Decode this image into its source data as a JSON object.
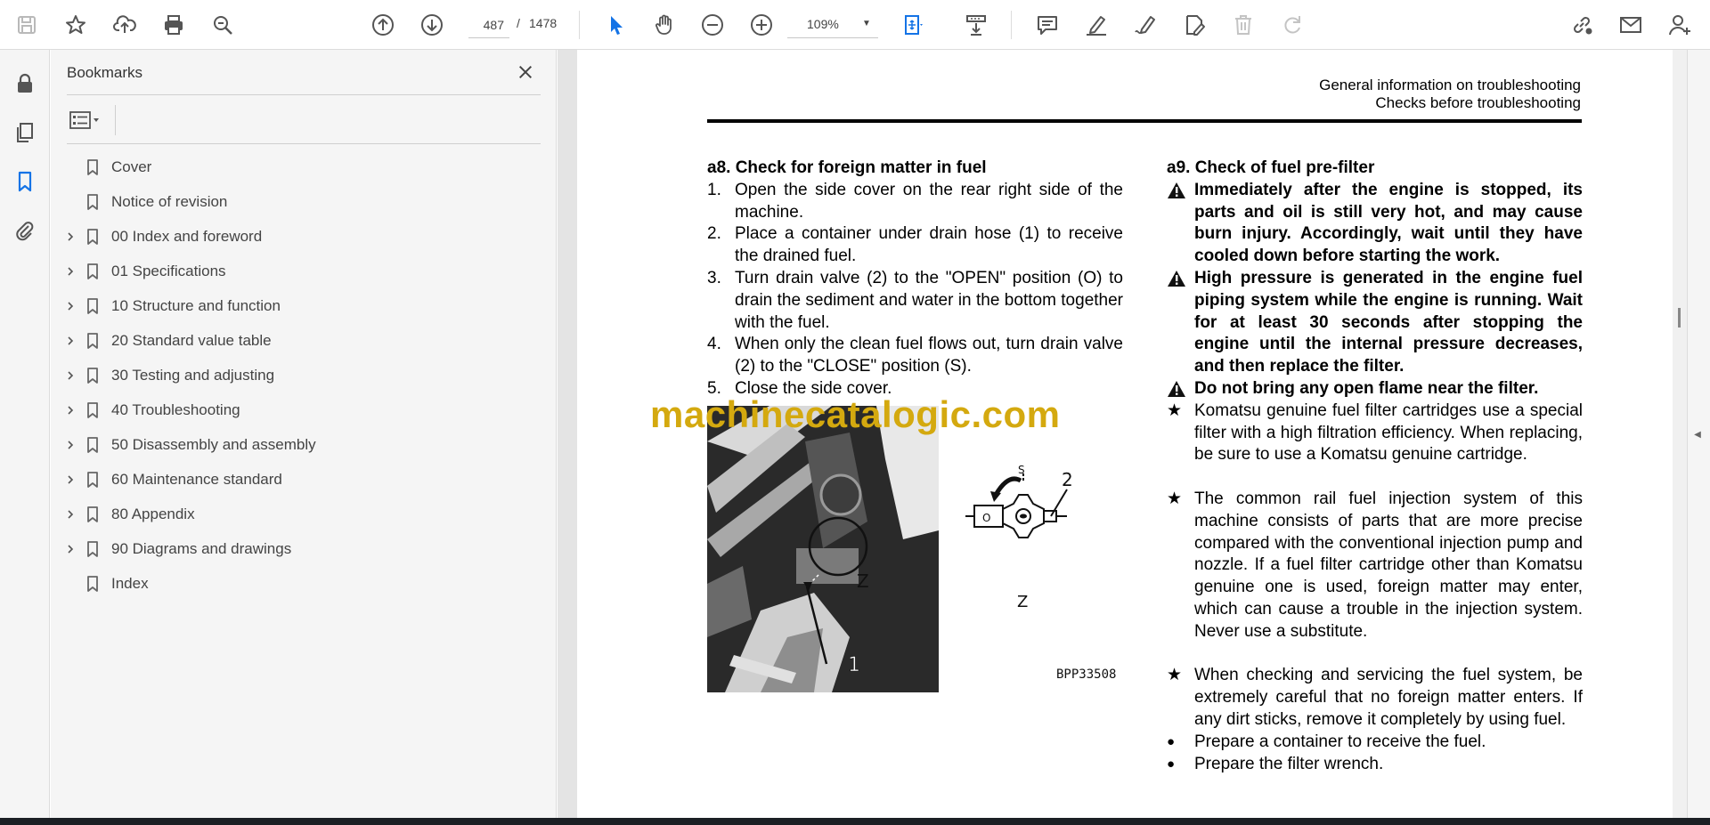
{
  "toolbar": {
    "icons": [
      "save-icon",
      "star-icon",
      "upload-icon",
      "print-icon",
      "zoom-search-icon",
      "page-up-icon",
      "page-down-icon",
      "select-icon",
      "hand-icon",
      "zoom-out-icon",
      "zoom-in-icon",
      "fit-page-icon",
      "scroll-mode-icon",
      "comment-icon",
      "highlight-icon",
      "sign-icon",
      "fill-sign-icon",
      "delete-icon",
      "redo-icon",
      "share-link-icon",
      "email-icon",
      "account-icon"
    ],
    "page_current": "487",
    "page_sep": "/",
    "page_total": "1478",
    "zoom": "109%",
    "accent": "#1473e6"
  },
  "bookmarks": {
    "title": "Bookmarks",
    "items": [
      {
        "label": "Cover",
        "expandable": false
      },
      {
        "label": "Notice of revision",
        "expandable": false
      },
      {
        "label": "00 Index and foreword",
        "expandable": true
      },
      {
        "label": "01 Specifications",
        "expandable": true
      },
      {
        "label": "10 Structure and function",
        "expandable": true
      },
      {
        "label": "20 Standard value table",
        "expandable": true
      },
      {
        "label": "30 Testing and adjusting",
        "expandable": true
      },
      {
        "label": "40 Troubleshooting",
        "expandable": true
      },
      {
        "label": "50 Disassembly and assembly",
        "expandable": true
      },
      {
        "label": "60 Maintenance standard",
        "expandable": true
      },
      {
        "label": "80 Appendix",
        "expandable": true
      },
      {
        "label": "90 Diagrams and drawings",
        "expandable": true
      },
      {
        "label": "Index",
        "expandable": false
      }
    ]
  },
  "doc": {
    "header_line1": "General information on troubleshooting",
    "header_line2": "Checks before troubleshooting",
    "a8": {
      "title": "a8. Check for foreign matter in fuel",
      "steps": [
        {
          "n": "1.",
          "text": "Open the side cover on the rear right side of the machine."
        },
        {
          "n": "2.",
          "text": "Place a container under drain hose (1) to receive the drained fuel."
        },
        {
          "n": "3.",
          "text": "Turn drain valve (2) to the \"OPEN\" position (O) to drain the sediment and water in the bottom together with the fuel."
        },
        {
          "n": "4.",
          "text": "When only the clean fuel flows out, turn drain valve (2) to the \"CLOSE\" position (S)."
        },
        {
          "n": "5.",
          "text": "Close the side cover."
        }
      ]
    },
    "figure": {
      "code": "BPP33508",
      "label_z": "Z",
      "label_1": "1",
      "label_2": "2",
      "label_s": "S",
      "label_o": "O"
    },
    "a9": {
      "title": "a9. Check of fuel pre-filter",
      "warnings": [
        "Immediately after the engine is stopped, its parts and oil is still very hot, and may cause burn injury. Accordingly, wait until they have cooled down before starting the work.",
        "High pressure is generated in the engine fuel piping system while the engine is running. Wait for at least 30 seconds after stopping the engine until the internal pressure decreases, and then replace the filter.",
        "Do not bring any open flame near the filter."
      ],
      "notes": [
        "Komatsu genuine fuel filter cartridges use a special filter with a high filtration efficiency. When replacing, be sure to use a Komatsu genuine cartridge.",
        "The common rail fuel injection system of this machine consists of parts that are more precise compared with the conventional injection pump and nozzle. If a fuel filter cartridge other than Komatsu genuine one is used, foreign matter may enter, which can cause a trouble in the injection system. Never use a substitute.",
        "When checking and servicing the fuel system, be extremely careful that no foreign matter enters. If any dirt sticks, remove it completely by using fuel."
      ],
      "bullets": [
        "Prepare a container to receive the fuel.",
        "Prepare the filter wrench."
      ],
      "star": "★",
      "dot": "●"
    },
    "watermark": "machinecatalogic.com"
  }
}
